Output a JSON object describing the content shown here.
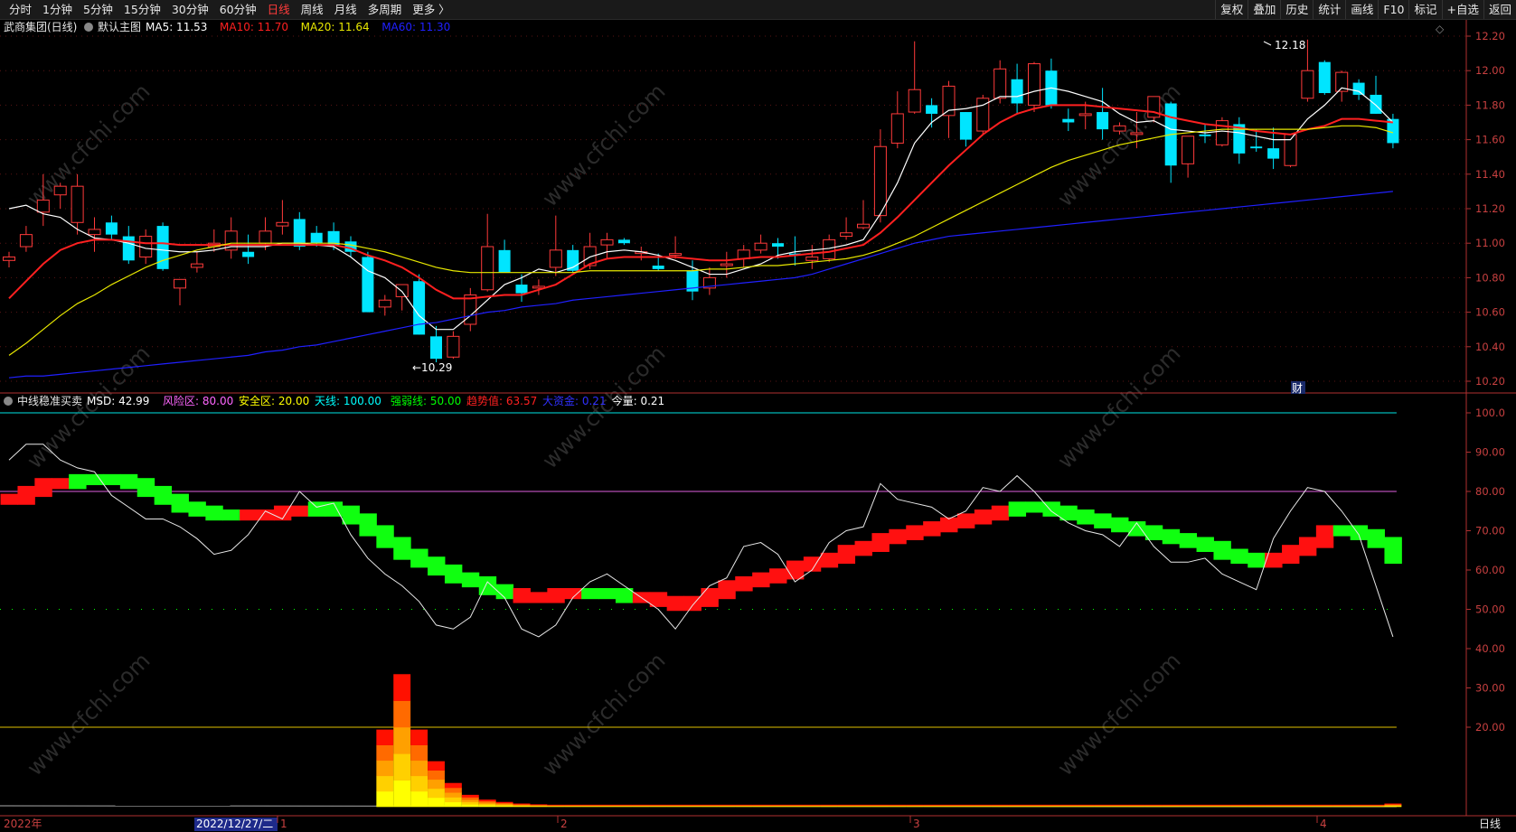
{
  "toolbar": {
    "left": [
      "分时",
      "1分钟",
      "5分钟",
      "15分钟",
      "30分钟",
      "60分钟",
      "日线",
      "周线",
      "月线",
      "多周期",
      "更多 〉"
    ],
    "active_index": 6,
    "right": [
      "复权",
      "叠加",
      "历史",
      "统计",
      "画线",
      "F10",
      "标记",
      "+自选",
      "返回"
    ]
  },
  "main_panel": {
    "title": "武商集团(日线)",
    "template": "默认主图",
    "ma": [
      {
        "label": "MA5: 11.53",
        "color": "#ffffff"
      },
      {
        "label": "MA10: 11.70",
        "color": "#ff2020"
      },
      {
        "label": "MA20: 11.64",
        "color": "#e8e800"
      },
      {
        "label": "MA60: 11.30",
        "color": "#2020ff"
      }
    ],
    "y_ticks": [
      "12.20",
      "12.00",
      "11.80",
      "11.60",
      "11.40",
      "11.20",
      "11.00",
      "10.80",
      "10.60",
      "10.40",
      "10.20"
    ],
    "high_label": "12.18",
    "low_label": "←10.29",
    "cai_label": "财"
  },
  "indicator_panel": {
    "name": "中线稳准买卖",
    "items": [
      {
        "label": "MSD: 42.99",
        "color": "#ffffff"
      },
      {
        "label": "风险区: 80.00",
        "color": "#ff66ff"
      },
      {
        "label": "安全区: 20.00",
        "color": "#ffff00"
      },
      {
        "label": "天线: 100.00",
        "color": "#00ffff"
      },
      {
        "label": "强弱线: 50.00",
        "color": "#00ff00"
      },
      {
        "label": "趋势值: 63.57",
        "color": "#ff2020"
      },
      {
        "label": "大资金: 0.21",
        "color": "#3030ff"
      },
      {
        "label": "今量: 0.21",
        "color": "#ffffff"
      }
    ],
    "y_ticks": [
      "100.0",
      "90.00",
      "80.00",
      "70.00",
      "60.00",
      "50.00",
      "40.00",
      "30.00",
      "20.00"
    ]
  },
  "footer": {
    "year": "2022年",
    "cursor_date": "2022/12/27/二",
    "months": [
      "1",
      "2",
      "3",
      "4"
    ],
    "period": "日线"
  },
  "watermark": "www.cfchi.com",
  "chart_data": {
    "type": "candlestick",
    "count": 82,
    "ohlc": [
      [
        10.9,
        10.95,
        10.86,
        10.92
      ],
      [
        10.98,
        11.1,
        10.95,
        11.05
      ],
      [
        11.18,
        11.4,
        11.1,
        11.25
      ],
      [
        11.28,
        11.35,
        11.2,
        11.33
      ],
      [
        11.12,
        11.4,
        11.05,
        11.33
      ],
      [
        11.05,
        11.15,
        10.95,
        11.08
      ],
      [
        11.12,
        11.16,
        11.02,
        11.05
      ],
      [
        11.04,
        11.1,
        10.88,
        10.9
      ],
      [
        10.92,
        11.08,
        10.88,
        11.04
      ],
      [
        11.1,
        11.12,
        10.84,
        10.85
      ],
      [
        10.74,
        10.78,
        10.64,
        10.79
      ],
      [
        10.86,
        10.95,
        10.83,
        10.88
      ],
      [
        10.98,
        11.08,
        10.95,
        11.0
      ],
      [
        10.96,
        11.15,
        10.91,
        11.07
      ],
      [
        10.95,
        11.05,
        10.88,
        10.92
      ],
      [
        11.0,
        11.15,
        10.96,
        11.07
      ],
      [
        11.1,
        11.25,
        11.05,
        11.12
      ],
      [
        11.14,
        11.18,
        10.96,
        10.98
      ],
      [
        11.06,
        11.1,
        10.98,
        11.0
      ],
      [
        11.07,
        11.12,
        10.96,
        10.99
      ],
      [
        11.01,
        11.04,
        10.92,
        10.95
      ],
      [
        10.92,
        10.95,
        10.6,
        10.6
      ],
      [
        10.63,
        10.7,
        10.58,
        10.67
      ],
      [
        10.69,
        10.75,
        10.61,
        10.76
      ],
      [
        10.78,
        10.82,
        10.47,
        10.47
      ],
      [
        10.46,
        10.52,
        10.31,
        10.33
      ],
      [
        10.34,
        10.49,
        10.33,
        10.46
      ],
      [
        10.53,
        10.74,
        10.49,
        10.7
      ],
      [
        10.73,
        11.17,
        10.72,
        10.98
      ],
      [
        10.96,
        11.02,
        10.83,
        10.83
      ],
      [
        10.76,
        10.82,
        10.66,
        10.71
      ],
      [
        10.74,
        10.79,
        10.7,
        10.75
      ],
      [
        10.86,
        11.16,
        10.81,
        10.96
      ],
      [
        10.96,
        10.99,
        10.83,
        10.84
      ],
      [
        10.87,
        11.06,
        10.85,
        10.98
      ],
      [
        10.99,
        11.06,
        10.91,
        11.02
      ],
      [
        11.02,
        11.03,
        10.99,
        11.0
      ],
      [
        10.94,
        10.98,
        10.9,
        10.95
      ],
      [
        10.87,
        10.94,
        10.84,
        10.85
      ],
      [
        10.93,
        11.04,
        10.91,
        10.94
      ],
      [
        10.84,
        10.9,
        10.67,
        10.72
      ],
      [
        10.74,
        10.86,
        10.7,
        10.8
      ],
      [
        10.87,
        10.95,
        10.8,
        10.88
      ],
      [
        10.91,
        10.99,
        10.86,
        10.96
      ],
      [
        10.96,
        11.05,
        10.94,
        11.0
      ],
      [
        11.0,
        11.03,
        10.91,
        10.98
      ],
      [
        10.94,
        11.04,
        10.87,
        10.93
      ],
      [
        10.9,
        10.99,
        10.85,
        10.92
      ],
      [
        10.91,
        11.05,
        10.89,
        11.02
      ],
      [
        11.04,
        11.15,
        11.02,
        11.06
      ],
      [
        11.09,
        11.25,
        11.08,
        11.11
      ],
      [
        11.16,
        11.66,
        11.12,
        11.56
      ],
      [
        11.58,
        11.88,
        11.55,
        11.75
      ],
      [
        11.76,
        12.17,
        11.75,
        11.89
      ],
      [
        11.8,
        11.84,
        11.67,
        11.75
      ],
      [
        11.74,
        11.94,
        11.61,
        11.91
      ],
      [
        11.76,
        11.76,
        11.56,
        11.6
      ],
      [
        11.65,
        11.86,
        11.63,
        11.84
      ],
      [
        11.84,
        12.06,
        11.81,
        12.01
      ],
      [
        11.95,
        12.04,
        11.75,
        11.81
      ],
      [
        11.8,
        12.05,
        11.76,
        12.04
      ],
      [
        12.0,
        12.07,
        11.78,
        11.8
      ],
      [
        11.72,
        11.78,
        11.65,
        11.7
      ],
      [
        11.74,
        11.82,
        11.66,
        11.75
      ],
      [
        11.76,
        11.9,
        11.6,
        11.66
      ],
      [
        11.65,
        11.7,
        11.63,
        11.68
      ],
      [
        11.63,
        11.76,
        11.55,
        11.64
      ],
      [
        11.73,
        11.85,
        11.7,
        11.85
      ],
      [
        11.81,
        11.82,
        11.35,
        11.45
      ],
      [
        11.46,
        11.55,
        11.38,
        11.62
      ],
      [
        11.63,
        11.69,
        11.58,
        11.62
      ],
      [
        11.57,
        11.73,
        11.56,
        11.71
      ],
      [
        11.69,
        11.73,
        11.46,
        11.52
      ],
      [
        11.56,
        11.66,
        11.53,
        11.55
      ],
      [
        11.55,
        11.67,
        11.43,
        11.49
      ],
      [
        11.45,
        11.63,
        11.44,
        11.63
      ],
      [
        11.84,
        12.18,
        11.82,
        12.0
      ],
      [
        12.05,
        12.06,
        11.86,
        11.87
      ],
      [
        11.88,
        12.0,
        11.82,
        11.99
      ],
      [
        11.93,
        11.95,
        11.83,
        11.86
      ],
      [
        11.86,
        11.97,
        11.75,
        11.75
      ],
      [
        11.72,
        11.75,
        11.55,
        11.58
      ]
    ],
    "ma_series": [
      {
        "name": "MA5",
        "color": "#ffffff",
        "values": [
          11.2,
          11.22,
          11.17,
          11.15,
          11.08,
          11.03,
          11.02,
          11.0,
          10.97,
          10.96,
          10.95,
          10.95,
          10.96,
          10.98,
          10.98,
          10.98,
          11.0,
          11.0,
          10.99,
          10.98,
          10.92,
          10.84,
          10.8,
          10.72,
          10.58,
          10.5,
          10.5,
          10.58,
          10.67,
          10.76,
          10.8,
          10.85,
          10.83,
          10.86,
          10.92,
          10.95,
          10.96,
          10.95,
          10.93,
          10.9,
          10.86,
          10.82,
          10.82,
          10.85,
          10.88,
          10.93,
          10.95,
          10.96,
          10.97,
          10.99,
          11.02,
          11.17,
          11.35,
          11.58,
          11.7,
          11.77,
          11.78,
          11.8,
          11.85,
          11.85,
          11.88,
          11.9,
          11.88,
          11.85,
          11.82,
          11.75,
          11.7,
          11.71,
          11.66,
          11.65,
          11.64,
          11.65,
          11.64,
          11.62,
          11.6,
          11.6,
          11.72,
          11.8,
          11.9,
          11.88,
          11.8,
          11.7
        ]
      },
      {
        "name": "MA10",
        "color": "#ff2020",
        "values": [
          10.68,
          10.78,
          10.88,
          10.96,
          11.0,
          11.02,
          11.02,
          11.01,
          11.0,
          11.0,
          10.99,
          10.99,
          10.99,
          10.99,
          10.99,
          10.99,
          10.99,
          10.99,
          10.99,
          10.99,
          10.97,
          10.93,
          10.9,
          10.86,
          10.8,
          10.73,
          10.68,
          10.68,
          10.69,
          10.7,
          10.7,
          10.73,
          10.76,
          10.82,
          10.88,
          10.91,
          10.92,
          10.92,
          10.92,
          10.92,
          10.91,
          10.9,
          10.9,
          10.91,
          10.92,
          10.92,
          10.93,
          10.94,
          10.95,
          10.97,
          10.99,
          11.06,
          11.15,
          11.25,
          11.35,
          11.45,
          11.54,
          11.63,
          11.7,
          11.75,
          11.78,
          11.8,
          11.8,
          11.8,
          11.79,
          11.78,
          11.77,
          11.76,
          11.73,
          11.71,
          11.69,
          11.68,
          11.67,
          11.65,
          11.64,
          11.63,
          11.66,
          11.68,
          11.72,
          11.72,
          11.71,
          11.7
        ]
      },
      {
        "name": "MA20",
        "color": "#e8e800",
        "values": [
          10.35,
          10.42,
          10.5,
          10.58,
          10.65,
          10.7,
          10.76,
          10.81,
          10.86,
          10.9,
          10.93,
          10.96,
          10.98,
          11.0,
          11.0,
          11.0,
          11.0,
          11.0,
          11.0,
          11.0,
          10.99,
          10.97,
          10.95,
          10.92,
          10.89,
          10.86,
          10.84,
          10.83,
          10.83,
          10.83,
          10.83,
          10.83,
          10.83,
          10.83,
          10.84,
          10.84,
          10.84,
          10.84,
          10.84,
          10.84,
          10.84,
          10.85,
          10.85,
          10.86,
          10.87,
          10.87,
          10.88,
          10.89,
          10.9,
          10.91,
          10.93,
          10.96,
          11.0,
          11.04,
          11.09,
          11.14,
          11.19,
          11.24,
          11.29,
          11.34,
          11.39,
          11.44,
          11.48,
          11.51,
          11.54,
          11.57,
          11.59,
          11.61,
          11.63,
          11.64,
          11.65,
          11.66,
          11.66,
          11.66,
          11.66,
          11.66,
          11.66,
          11.67,
          11.68,
          11.68,
          11.67,
          11.64
        ]
      },
      {
        "name": "MA60",
        "color": "#2020ff",
        "values": [
          10.22,
          10.23,
          10.23,
          10.24,
          10.25,
          10.26,
          10.27,
          10.28,
          10.29,
          10.3,
          10.31,
          10.32,
          10.33,
          10.34,
          10.35,
          10.37,
          10.38,
          10.4,
          10.41,
          10.43,
          10.45,
          10.47,
          10.49,
          10.51,
          10.53,
          10.54,
          10.56,
          10.58,
          10.6,
          10.61,
          10.63,
          10.64,
          10.65,
          10.67,
          10.68,
          10.69,
          10.7,
          10.71,
          10.72,
          10.73,
          10.74,
          10.75,
          10.76,
          10.77,
          10.78,
          10.79,
          10.8,
          10.82,
          10.85,
          10.88,
          10.91,
          10.94,
          10.97,
          11.0,
          11.02,
          11.04,
          11.05,
          11.06,
          11.07,
          11.08,
          11.09,
          11.1,
          11.11,
          11.12,
          11.13,
          11.14,
          11.15,
          11.16,
          11.17,
          11.18,
          11.19,
          11.2,
          11.21,
          11.22,
          11.23,
          11.24,
          11.25,
          11.26,
          11.27,
          11.28,
          11.29,
          11.3
        ]
      }
    ],
    "msd": [
      88,
      92,
      92,
      88,
      86,
      85,
      79,
      76,
      73,
      73,
      71,
      68,
      64,
      65,
      69,
      75,
      73,
      80,
      76,
      77,
      69,
      63,
      59,
      56,
      52,
      46,
      45,
      48,
      57,
      53,
      45,
      43,
      46,
      53,
      57,
      59,
      56,
      53,
      50,
      45,
      51,
      56,
      58,
      66,
      67,
      64,
      57,
      60,
      67,
      70,
      71,
      82,
      78,
      77,
      76,
      73,
      75,
      81,
      80,
      84,
      80,
      75,
      72,
      70,
      69,
      66,
      72,
      66,
      62,
      62,
      63,
      59,
      57,
      55,
      68,
      75,
      81,
      80,
      75,
      69,
      56,
      43
    ],
    "trend": [
      78,
      80,
      82,
      82,
      83,
      83,
      83,
      82,
      80,
      78,
      76,
      75,
      74,
      74,
      74,
      74,
      75,
      75,
      76,
      75,
      73,
      70,
      67,
      64,
      62,
      60,
      58,
      57,
      55,
      54,
      53,
      53,
      54,
      54,
      54,
      54,
      53,
      53,
      52,
      51,
      52,
      54,
      56,
      57,
      58,
      59,
      61,
      62,
      63,
      65,
      66,
      68,
      69,
      70,
      71,
      72,
      73,
      74,
      75,
      76,
      76,
      75,
      74,
      73,
      72,
      71,
      70,
      69,
      68,
      67,
      66,
      64,
      63,
      62,
      63,
      65,
      67,
      70,
      70,
      69,
      67,
      63
    ],
    "trend_color": [
      "r",
      "r",
      "r",
      "r",
      "g",
      "g",
      "g",
      "g",
      "g",
      "g",
      "g",
      "g",
      "g",
      "g",
      "r",
      "r",
      "r",
      "r",
      "g",
      "g",
      "g",
      "g",
      "g",
      "g",
      "g",
      "g",
      "g",
      "g",
      "g",
      "g",
      "r",
      "r",
      "r",
      "r",
      "g",
      "g",
      "g",
      "r",
      "r",
      "r",
      "r",
      "r",
      "r",
      "r",
      "r",
      "r",
      "r",
      "r",
      "r",
      "r",
      "r",
      "r",
      "r",
      "r",
      "r",
      "r",
      "r",
      "r",
      "r",
      "g",
      "g",
      "g",
      "g",
      "g",
      "g",
      "g",
      "g",
      "g",
      "g",
      "g",
      "g",
      "g",
      "g",
      "g",
      "r",
      "r",
      "r",
      "r",
      "g",
      "g",
      "g",
      "g"
    ],
    "volume_bars": [
      0,
      0,
      0,
      0,
      0,
      0,
      0,
      0,
      0,
      0,
      0,
      0,
      0,
      0,
      0,
      0,
      0,
      0,
      0,
      0,
      0,
      0,
      19.5,
      33.5,
      19.5,
      11.5,
      6.0,
      3.0,
      1.8,
      1.2,
      0.8,
      0.6,
      0.5,
      0.5,
      0.5,
      0.5,
      0.5,
      0.5,
      0.5,
      0.5,
      0.5,
      0.5,
      0.5,
      0.5,
      0.5,
      0.5,
      0.5,
      0.5,
      0.5,
      0.5,
      0.5,
      0.5,
      0.5,
      0.5,
      0.5,
      0.5,
      0.5,
      0.5,
      0.5,
      0.5,
      0.5,
      0.5,
      0.5,
      0.5,
      0.5,
      0.5,
      0.5,
      0.5,
      0.5,
      0.5,
      0.5,
      0.5,
      0.5,
      0.5,
      0.5,
      0.5,
      0.5,
      0.5,
      0.5,
      0.5,
      0.5,
      0.8
    ]
  }
}
